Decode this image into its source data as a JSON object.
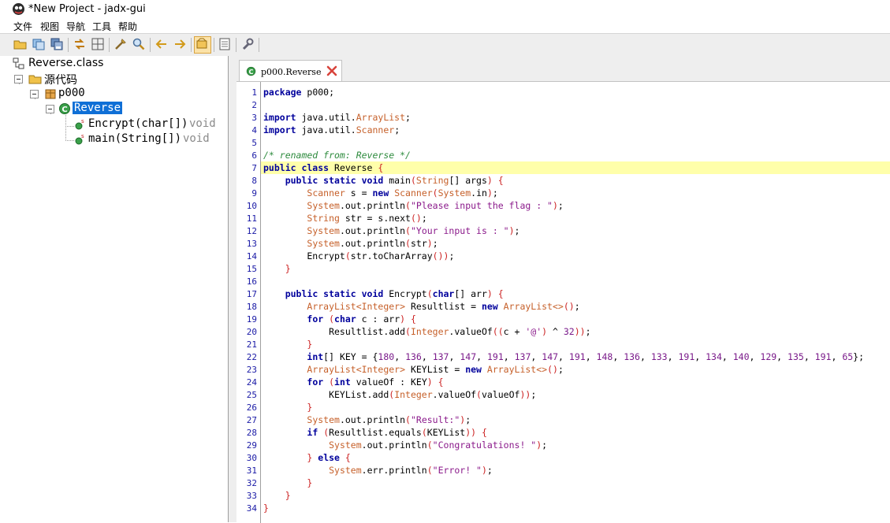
{
  "window": {
    "title": "*New Project - jadx-gui",
    "icon": "jadx-app-icon"
  },
  "menu": [
    "文件",
    "视图",
    "导航",
    "工具",
    "帮助"
  ],
  "toolbar": {
    "buttons": [
      "open-file-icon",
      "add-files-icon",
      "save-all-icon",
      "sync-icon",
      "flatten-packages-icon",
      "decompile-all-icon",
      "search-icon",
      "back-icon",
      "forward-icon",
      "deobfuscation-icon",
      "log-icon",
      "preferences-icon"
    ],
    "active": "deobfuscation-icon"
  },
  "tree": {
    "root": "Reverse.class",
    "source_folder": "源代码",
    "package": "p000",
    "class": "Reverse",
    "methods": [
      {
        "name": "Encrypt(char[])",
        "return": "void"
      },
      {
        "name": "main(String[])",
        "return": "void"
      }
    ]
  },
  "tab": {
    "label": "p000.Reverse",
    "close": "close-icon"
  },
  "editor": {
    "highlighted_line": 7,
    "line_count": 34,
    "lines": [
      [
        [
          "kw",
          "package"
        ],
        [
          "",
          " p000;"
        ]
      ],
      [],
      [
        [
          "kw",
          "import"
        ],
        [
          "",
          " java.util."
        ],
        [
          "ty",
          "ArrayList"
        ],
        [
          "",
          ";"
        ]
      ],
      [
        [
          "kw",
          "import"
        ],
        [
          "",
          " java.util."
        ],
        [
          "ty",
          "Scanner"
        ],
        [
          "",
          ";"
        ]
      ],
      [],
      [
        [
          "cm",
          "/* renamed from: Reverse */"
        ]
      ],
      [
        [
          "kw",
          "public class"
        ],
        [
          "",
          " Reverse "
        ],
        [
          "pu",
          "{"
        ]
      ],
      [
        [
          "",
          "    "
        ],
        [
          "kw",
          "public static void"
        ],
        [
          "",
          " main"
        ],
        [
          "pu",
          "("
        ],
        [
          "ty",
          "String"
        ],
        [
          "",
          "[] args"
        ],
        [
          "pu",
          ")"
        ],
        [
          "",
          " "
        ],
        [
          "pu",
          "{"
        ]
      ],
      [
        [
          "",
          "        "
        ],
        [
          "ty",
          "Scanner"
        ],
        [
          "",
          " s = "
        ],
        [
          "kw",
          "new"
        ],
        [
          "",
          " "
        ],
        [
          "ty",
          "Scanner"
        ],
        [
          "pu",
          "("
        ],
        [
          "ty",
          "System"
        ],
        [
          "",
          ".in"
        ],
        [
          "pu",
          ")"
        ],
        [
          "",
          ";"
        ]
      ],
      [
        [
          "",
          "        "
        ],
        [
          "ty",
          "System"
        ],
        [
          "",
          ".out.println"
        ],
        [
          "pu",
          "("
        ],
        [
          "st",
          "\"Please input the flag : \""
        ],
        [
          "pu",
          ")"
        ],
        [
          "",
          ";"
        ]
      ],
      [
        [
          "",
          "        "
        ],
        [
          "ty",
          "String"
        ],
        [
          "",
          " str = s.next"
        ],
        [
          "pu",
          "()"
        ],
        [
          "",
          ";"
        ]
      ],
      [
        [
          "",
          "        "
        ],
        [
          "ty",
          "System"
        ],
        [
          "",
          ".out.println"
        ],
        [
          "pu",
          "("
        ],
        [
          "st",
          "\"Your input is : \""
        ],
        [
          "pu",
          ")"
        ],
        [
          "",
          ";"
        ]
      ],
      [
        [
          "",
          "        "
        ],
        [
          "ty",
          "System"
        ],
        [
          "",
          ".out.println"
        ],
        [
          "pu",
          "("
        ],
        [
          "",
          "str"
        ],
        [
          "pu",
          ")"
        ],
        [
          "",
          ";"
        ]
      ],
      [
        [
          "",
          "        Encrypt"
        ],
        [
          "pu",
          "("
        ],
        [
          "",
          "str.toCharArray"
        ],
        [
          "pu",
          "())"
        ],
        [
          "",
          ";"
        ]
      ],
      [
        [
          "",
          "    "
        ],
        [
          "pu",
          "}"
        ]
      ],
      [],
      [
        [
          "",
          "    "
        ],
        [
          "kw",
          "public static void"
        ],
        [
          "",
          " Encrypt"
        ],
        [
          "pu",
          "("
        ],
        [
          "kw",
          "char"
        ],
        [
          "",
          "[] arr"
        ],
        [
          "pu",
          ")"
        ],
        [
          "",
          " "
        ],
        [
          "pu",
          "{"
        ]
      ],
      [
        [
          "",
          "        "
        ],
        [
          "ty",
          "ArrayList<Integer>"
        ],
        [
          "",
          " Resultlist = "
        ],
        [
          "kw",
          "new"
        ],
        [
          "",
          " "
        ],
        [
          "ty",
          "ArrayList<>"
        ],
        [
          "pu",
          "()"
        ],
        [
          "",
          ";"
        ]
      ],
      [
        [
          "",
          "        "
        ],
        [
          "kw",
          "for"
        ],
        [
          "",
          " "
        ],
        [
          "pu",
          "("
        ],
        [
          "kw",
          "char"
        ],
        [
          "",
          " c : arr"
        ],
        [
          "pu",
          ")"
        ],
        [
          "",
          " "
        ],
        [
          "pu",
          "{"
        ]
      ],
      [
        [
          "",
          "            Resultlist.add"
        ],
        [
          "pu",
          "("
        ],
        [
          "ty",
          "Integer"
        ],
        [
          "",
          ".valueOf"
        ],
        [
          "pu",
          "(("
        ],
        [
          "",
          "c + "
        ],
        [
          "st",
          "'@'"
        ],
        [
          "pu",
          ")"
        ],
        [
          "",
          " ^ "
        ],
        [
          "nm",
          "32"
        ],
        [
          "pu",
          "))"
        ],
        [
          "",
          ";"
        ]
      ],
      [
        [
          "",
          "        "
        ],
        [
          "pu",
          "}"
        ]
      ],
      [
        [
          "",
          "        "
        ],
        [
          "kw",
          "int"
        ],
        [
          "",
          "[] KEY = {"
        ],
        [
          "nm",
          "180"
        ],
        [
          "",
          ", "
        ],
        [
          "nm",
          "136"
        ],
        [
          "",
          ", "
        ],
        [
          "nm",
          "137"
        ],
        [
          "",
          ", "
        ],
        [
          "nm",
          "147"
        ],
        [
          "",
          ", "
        ],
        [
          "nm",
          "191"
        ],
        [
          "",
          ", "
        ],
        [
          "nm",
          "137"
        ],
        [
          "",
          ", "
        ],
        [
          "nm",
          "147"
        ],
        [
          "",
          ", "
        ],
        [
          "nm",
          "191"
        ],
        [
          "",
          ", "
        ],
        [
          "nm",
          "148"
        ],
        [
          "",
          ", "
        ],
        [
          "nm",
          "136"
        ],
        [
          "",
          ", "
        ],
        [
          "nm",
          "133"
        ],
        [
          "",
          ", "
        ],
        [
          "nm",
          "191"
        ],
        [
          "",
          ", "
        ],
        [
          "nm",
          "134"
        ],
        [
          "",
          ", "
        ],
        [
          "nm",
          "140"
        ],
        [
          "",
          ", "
        ],
        [
          "nm",
          "129"
        ],
        [
          "",
          ", "
        ],
        [
          "nm",
          "135"
        ],
        [
          "",
          ", "
        ],
        [
          "nm",
          "191"
        ],
        [
          "",
          ", "
        ],
        [
          "nm",
          "65"
        ],
        [
          "",
          "};"
        ]
      ],
      [
        [
          "",
          "        "
        ],
        [
          "ty",
          "ArrayList<Integer>"
        ],
        [
          "",
          " KEYList = "
        ],
        [
          "kw",
          "new"
        ],
        [
          "",
          " "
        ],
        [
          "ty",
          "ArrayList<>"
        ],
        [
          "pu",
          "()"
        ],
        [
          "",
          ";"
        ]
      ],
      [
        [
          "",
          "        "
        ],
        [
          "kw",
          "for"
        ],
        [
          "",
          " "
        ],
        [
          "pu",
          "("
        ],
        [
          "kw",
          "int"
        ],
        [
          "",
          " valueOf : KEY"
        ],
        [
          "pu",
          ")"
        ],
        [
          "",
          " "
        ],
        [
          "pu",
          "{"
        ]
      ],
      [
        [
          "",
          "            KEYList.add"
        ],
        [
          "pu",
          "("
        ],
        [
          "ty",
          "Integer"
        ],
        [
          "",
          ".valueOf"
        ],
        [
          "pu",
          "("
        ],
        [
          "",
          "valueOf"
        ],
        [
          "pu",
          "))"
        ],
        [
          "",
          ";"
        ]
      ],
      [
        [
          "",
          "        "
        ],
        [
          "pu",
          "}"
        ]
      ],
      [
        [
          "",
          "        "
        ],
        [
          "ty",
          "System"
        ],
        [
          "",
          ".out.println"
        ],
        [
          "pu",
          "("
        ],
        [
          "st",
          "\"Result:\""
        ],
        [
          "pu",
          ")"
        ],
        [
          "",
          ";"
        ]
      ],
      [
        [
          "",
          "        "
        ],
        [
          "kw",
          "if"
        ],
        [
          "",
          " "
        ],
        [
          "pu",
          "("
        ],
        [
          "",
          "Resultlist.equals"
        ],
        [
          "pu",
          "("
        ],
        [
          "",
          "KEYList"
        ],
        [
          "pu",
          "))"
        ],
        [
          "",
          " "
        ],
        [
          "pu",
          "{"
        ]
      ],
      [
        [
          "",
          "            "
        ],
        [
          "ty",
          "System"
        ],
        [
          "",
          ".out.println"
        ],
        [
          "pu",
          "("
        ],
        [
          "st",
          "\"Congratulations! \""
        ],
        [
          "pu",
          ")"
        ],
        [
          "",
          ";"
        ]
      ],
      [
        [
          "",
          "        "
        ],
        [
          "pu",
          "}"
        ],
        [
          "",
          " "
        ],
        [
          "kw",
          "else"
        ],
        [
          "",
          " "
        ],
        [
          "pu",
          "{"
        ]
      ],
      [
        [
          "",
          "            "
        ],
        [
          "ty",
          "System"
        ],
        [
          "",
          ".err.println"
        ],
        [
          "pu",
          "("
        ],
        [
          "st",
          "\"Error! \""
        ],
        [
          "pu",
          ")"
        ],
        [
          "",
          ";"
        ]
      ],
      [
        [
          "",
          "        "
        ],
        [
          "pu",
          "}"
        ]
      ],
      [
        [
          "",
          "    "
        ],
        [
          "pu",
          "}"
        ]
      ],
      [
        [
          "pu",
          "}"
        ]
      ]
    ]
  }
}
